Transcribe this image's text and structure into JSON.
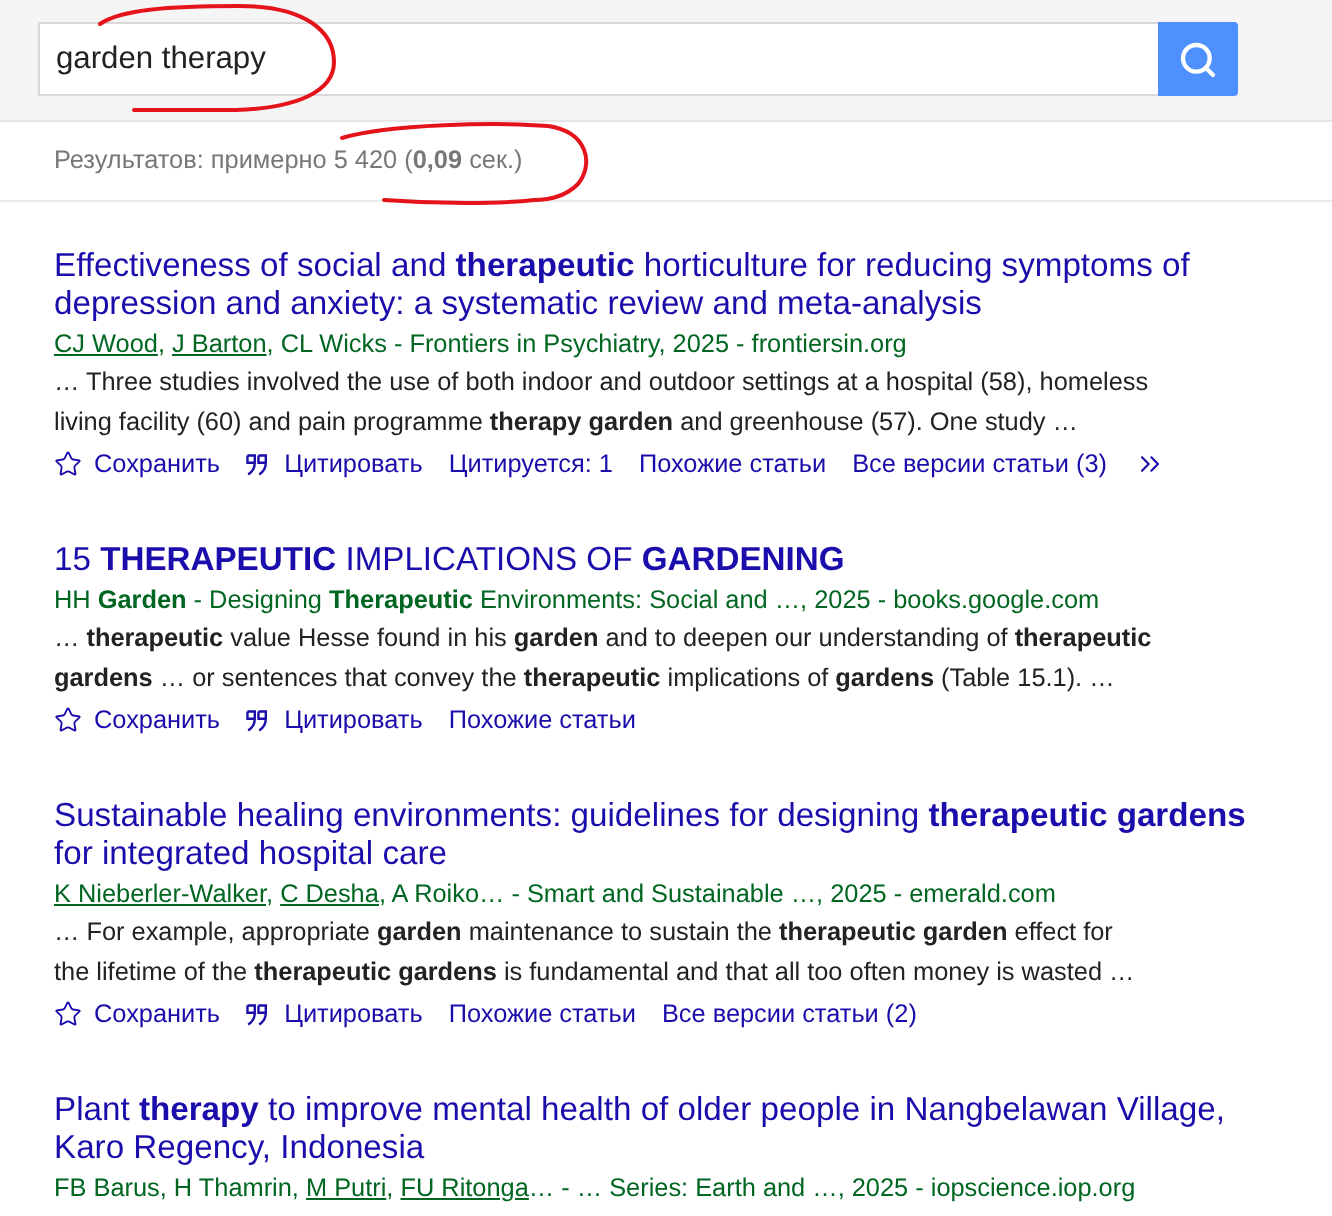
{
  "search": {
    "value": "garden therapy"
  },
  "stats": "Результатов: примерно 5 420 (**0,09** сек.)",
  "results": [
    {
      "title": "Effectiveness of social and **therapeutic** horticulture for reducing symptoms of depression and anxiety: a systematic review and meta-analysis",
      "byline": [
        {
          "text": "CJ Wood",
          "link": true,
          "suffix": ", "
        },
        {
          "text": "J Barton",
          "link": true
        },
        {
          "text": ", CL Wicks - Frontiers in Psychiatry, 2025 - frontiersin.org",
          "link": false
        }
      ],
      "snippet": "… Three studies involved the use of both indoor and outdoor settings at a hospital (58), homeless living facility (60) and pain programme **therapy garden** and greenhouse (57). One study …",
      "actions": [
        {
          "kind": "save",
          "label": "Сохранить"
        },
        {
          "kind": "cite",
          "label": "Цитировать"
        },
        {
          "kind": "link",
          "label": "Цитируется: 1"
        },
        {
          "kind": "link",
          "label": "Похожие статьи"
        },
        {
          "kind": "link",
          "label": "Все версии статьи (3)"
        },
        {
          "kind": "more"
        }
      ]
    },
    {
      "title": "15 **THERAPEUTIC** IMPLICATIONS OF **GARDENING**",
      "byline": [
        {
          "text": "HH **Garden** - Designing **Therapeutic** Environments: Social and …, 2025 - books.google.com",
          "link": false
        }
      ],
      "snippet": "… **therapeutic** value Hesse found in his **garden** and to deepen our understanding of **therapeutic gardens** … or sentences that convey the **therapeutic** implications of **gardens** (Table 15.1). …",
      "actions": [
        {
          "kind": "save",
          "label": "Сохранить"
        },
        {
          "kind": "cite",
          "label": "Цитировать"
        },
        {
          "kind": "link",
          "label": "Похожие статьи"
        }
      ]
    },
    {
      "title": "Sustainable healing environments: guidelines for designing **therapeutic gardens** for integrated hospital care",
      "byline": [
        {
          "text": "K Nieberler-Walker",
          "link": true,
          "suffix": ", "
        },
        {
          "text": "C Desha",
          "link": true
        },
        {
          "text": ", A Roiko… - Smart and Sustainable …, 2025 - emerald.com",
          "link": false
        }
      ],
      "snippet": "… For example, appropriate **garden** maintenance to sustain the **therapeutic garden** effect for the lifetime of the **therapeutic gardens** is fundamental and that all too often money is wasted …",
      "actions": [
        {
          "kind": "save",
          "label": "Сохранить"
        },
        {
          "kind": "cite",
          "label": "Цитировать"
        },
        {
          "kind": "link",
          "label": "Похожие статьи"
        },
        {
          "kind": "link",
          "label": "Все версии статьи (2)"
        }
      ]
    },
    {
      "title": "Plant **therapy** to improve mental health of older people in Nangbelawan Village, Karo Regency, Indonesia",
      "byline": [
        {
          "text": "FB Barus, H Thamrin, ",
          "link": false
        },
        {
          "text": "M Putri",
          "link": true,
          "suffix": ", "
        },
        {
          "text": "FU Ritonga",
          "link": true
        },
        {
          "text": "… - … Series: Earth and …, 2025 - iopscience.iop.org",
          "link": false
        }
      ]
    }
  ]
}
